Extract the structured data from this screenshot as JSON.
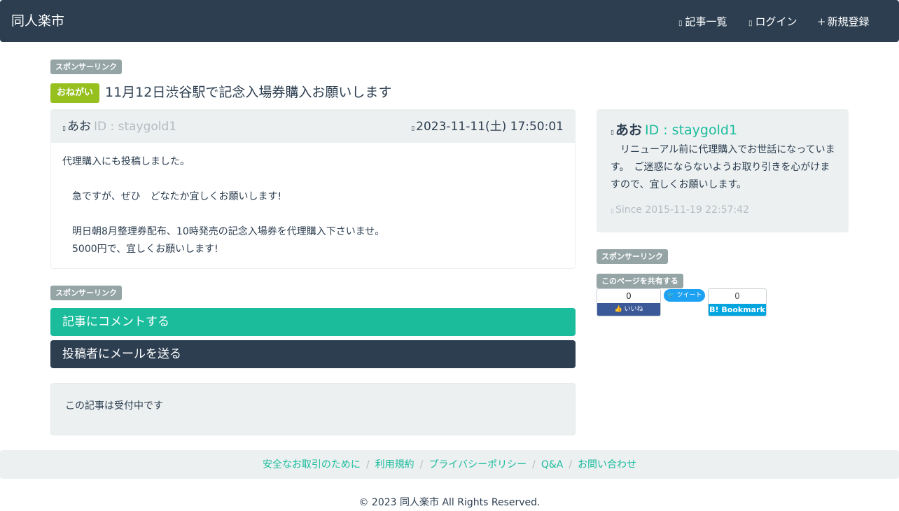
{
  "navbar": {
    "brand": "同人楽市",
    "links": [
      {
        "icon": "list-icon",
        "glyph": "▯",
        "label": "記事一覧"
      },
      {
        "icon": "login-icon",
        "glyph": "▯",
        "label": "ログイン"
      },
      {
        "icon": "plus-icon",
        "glyph": "+",
        "label": "新規登録"
      }
    ]
  },
  "sponsor_label": "スポンサーリンク",
  "article": {
    "badge": "おねがい",
    "title": "11月12日渋谷駅で記念入場券購入お願いします",
    "author": "あお",
    "author_id": "ID : staygold1",
    "date": "2023-11-11(土) 17:50:01",
    "body_lines": [
      "代理購入にも投稿しました。",
      "",
      "　急ですが、ぜひ　どなたか宜しくお願いします!",
      "",
      "　明日朝8月整理券配布、10時発売の記念入場券を代理購入下さいませ。",
      "　5000円で、宜しくお願いします!"
    ]
  },
  "actions": {
    "comment_label": "記事にコメントする",
    "mail_label": "投稿者にメールを送る"
  },
  "status": {
    "text": "この記事は受付中です"
  },
  "profile": {
    "name": "あお",
    "id": "ID : staygold1",
    "bio": "　リニューアル前に代理購入でお世話になっています。　ご迷惑にならないようお取り引きを心がけますので、宜しくお願いします。",
    "since": "Since 2015-11-19 22:57:42"
  },
  "share": {
    "label": "このページを共有する",
    "fb_count": "0",
    "fb_like": "👍 いいね",
    "tweet": "ツイート",
    "hb_count": "0",
    "hb_label": "B! Bookmark"
  },
  "footer": {
    "links": [
      "安全なお取引のために",
      "利用規約",
      "プライバシーポリシー",
      "Q&A",
      "お問い合わせ"
    ],
    "copyright": "© 2023 同人楽市 All Rights Reserved."
  },
  "colors": {
    "navbar": "#2c3e50",
    "accent": "#1abc9c",
    "badge": "#96c01e",
    "muted": "#95a5a6",
    "well": "#ecf0f1"
  }
}
